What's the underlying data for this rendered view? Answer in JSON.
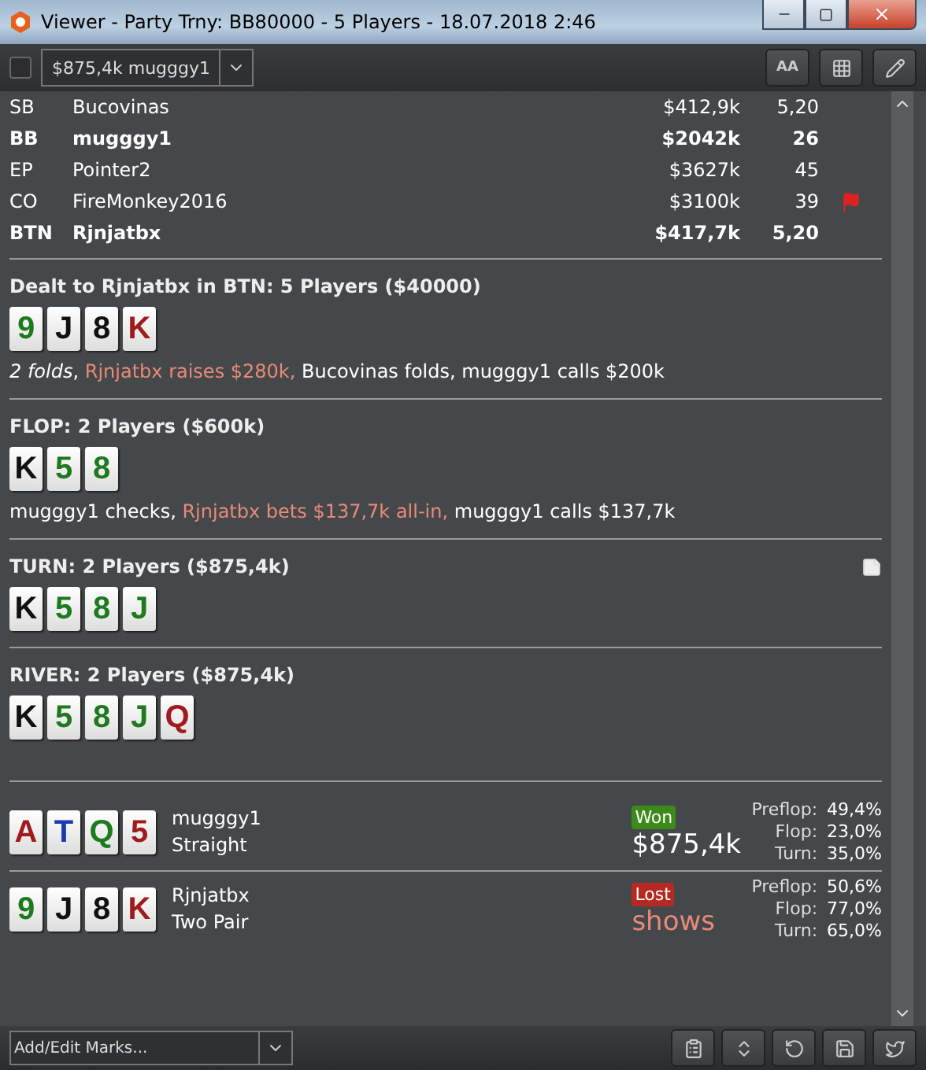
{
  "window": {
    "title": "Viewer - Party Trny: BB80000 - 5 Players - 18.07.2018 2:46"
  },
  "toolbar": {
    "checked": false,
    "hand_select": "$875,4k mugggy1",
    "font_button": "AA"
  },
  "players": [
    {
      "position": "SB",
      "name": "Bucovinas",
      "stack": "$412,9k",
      "bb": "5,20",
      "bold": false,
      "flag": false
    },
    {
      "position": "BB",
      "name": "mugggy1",
      "stack": "$2042k",
      "bb": "26",
      "bold": true,
      "flag": false
    },
    {
      "position": "EP",
      "name": "Pointer2",
      "stack": "$3627k",
      "bb": "45",
      "bold": false,
      "flag": false
    },
    {
      "position": "CO",
      "name": "FireMonkey2016",
      "stack": "$3100k",
      "bb": "39",
      "bold": false,
      "flag": true
    },
    {
      "position": "BTN",
      "name": "Rjnjatbx",
      "stack": "$417,7k",
      "bb": "5,20",
      "bold": true,
      "flag": false
    }
  ],
  "streets": [
    {
      "title": "Dealt to Rjnjatbx in BTN: 5 Players ($40000)",
      "note": false,
      "cards": [
        {
          "rank": "9",
          "color": "#1e7a1e"
        },
        {
          "rank": "J",
          "color": "#111111"
        },
        {
          "rank": "8",
          "color": "#111111"
        },
        {
          "rank": "K",
          "color": "#a01c1c"
        }
      ],
      "actions": [
        {
          "kind": "italic",
          "text": "2 folds"
        },
        {
          "kind": "plain",
          "text": ", "
        },
        {
          "kind": "aggressive",
          "text": "Rjnjatbx raises $280k,"
        },
        {
          "kind": "plain",
          "text": " Bucovinas folds, mugggy1 calls $200k"
        }
      ]
    },
    {
      "title": "FLOP: 2 Players ($600k)",
      "note": false,
      "cards": [
        {
          "rank": "K",
          "color": "#111111"
        },
        {
          "rank": "5",
          "color": "#1e7a1e"
        },
        {
          "rank": "8",
          "color": "#1e7a1e"
        }
      ],
      "actions": [
        {
          "kind": "plain",
          "text": "mugggy1 checks, "
        },
        {
          "kind": "aggressive",
          "text": "Rjnjatbx bets $137,7k all-in,"
        },
        {
          "kind": "plain",
          "text": " mugggy1 calls $137,7k"
        }
      ]
    },
    {
      "title": "TURN: 2 Players ($875,4k)",
      "note": true,
      "cards": [
        {
          "rank": "K",
          "color": "#111111"
        },
        {
          "rank": "5",
          "color": "#1e7a1e"
        },
        {
          "rank": "8",
          "color": "#1e7a1e"
        },
        {
          "rank": "J",
          "color": "#1e7a1e"
        }
      ]
    },
    {
      "title": "RIVER: 2 Players ($875,4k)",
      "note": false,
      "cards": [
        {
          "rank": "K",
          "color": "#111111"
        },
        {
          "rank": "5",
          "color": "#1e7a1e"
        },
        {
          "rank": "8",
          "color": "#1e7a1e"
        },
        {
          "rank": "J",
          "color": "#1e7a1e"
        },
        {
          "rank": "Q",
          "color": "#a01c1c"
        }
      ]
    }
  ],
  "showdown": [
    {
      "cards": [
        {
          "rank": "A",
          "color": "#a01c1c"
        },
        {
          "rank": "T",
          "color": "#1a3bb0"
        },
        {
          "rank": "Q",
          "color": "#1e7a1e"
        },
        {
          "rank": "5",
          "color": "#a01c1c"
        }
      ],
      "name": "mugggy1",
      "hand": "Straight",
      "won": true,
      "result_label": "Won",
      "amount": "$875,4k",
      "equity": [
        {
          "label": "Preflop:",
          "value": "49,4%"
        },
        {
          "label": "Flop:",
          "value": "23,0%"
        },
        {
          "label": "Turn:",
          "value": "35,0%"
        }
      ]
    },
    {
      "cards": [
        {
          "rank": "9",
          "color": "#1e7a1e"
        },
        {
          "rank": "J",
          "color": "#111111"
        },
        {
          "rank": "8",
          "color": "#111111"
        },
        {
          "rank": "K",
          "color": "#a01c1c"
        }
      ],
      "name": "Rjnjatbx",
      "hand": "Two Pair",
      "won": false,
      "result_label": "Lost",
      "amount": "shows",
      "equity": [
        {
          "label": "Preflop:",
          "value": "50,6%"
        },
        {
          "label": "Flop:",
          "value": "77,0%"
        },
        {
          "label": "Turn:",
          "value": "65,0%"
        }
      ]
    }
  ],
  "bottom": {
    "marks_placeholder": "Add/Edit Marks..."
  }
}
